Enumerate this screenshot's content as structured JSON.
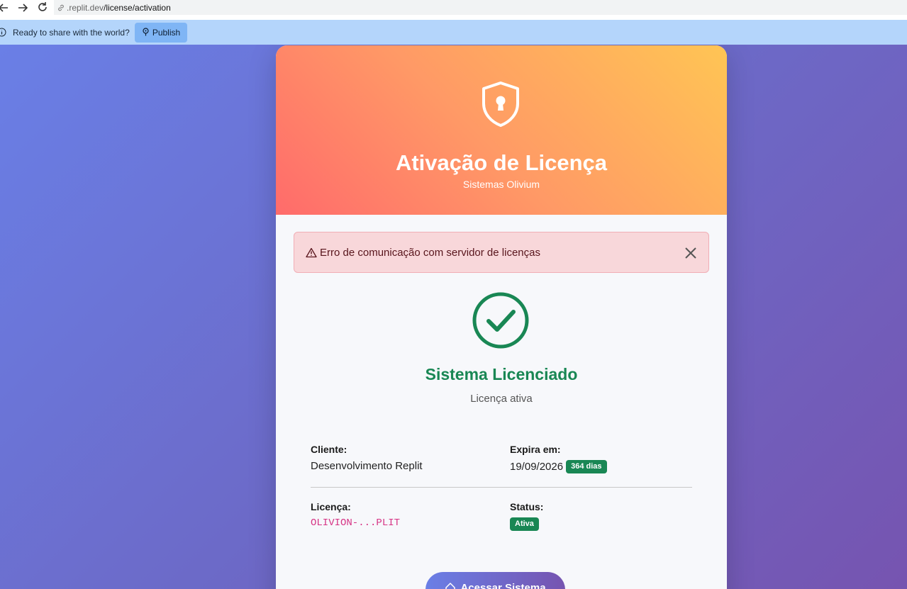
{
  "browser": {
    "url_host": ".replit.dev",
    "url_path": "/license/activation"
  },
  "sharebar": {
    "message": "Ready to share with the world?",
    "publish_label": "Publish"
  },
  "card": {
    "title": "Ativação de Licença",
    "subtitle": "Sistemas Olivium",
    "alert": {
      "icon": "warning-icon",
      "text": "Erro de comunicação com servidor de licenças"
    },
    "status_title": "Sistema Licenciado",
    "status_sub": "Licença ativa",
    "details": {
      "client_label": "Cliente:",
      "client_value": "Desenvolvimento Replit",
      "expires_label": "Expira em:",
      "expires_value": "19/09/2026",
      "expires_badge": "364 dias",
      "license_label": "Licença:",
      "license_value": "OLIVION-...PLIT",
      "status_label": "Status:",
      "status_badge": "Ativa"
    },
    "access_button": "Acessar Sistema"
  },
  "colors": {
    "success": "#198754",
    "alert_bg": "#f8d7da",
    "header_from": "#ff6b6b",
    "header_to": "#ffc554"
  }
}
